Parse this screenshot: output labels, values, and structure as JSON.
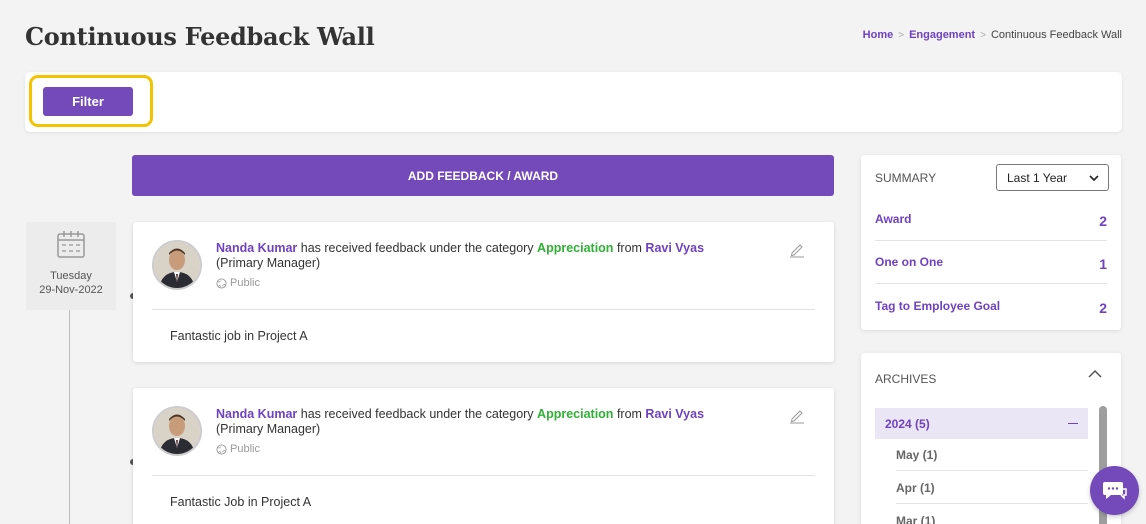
{
  "page": {
    "title": "Continuous Feedback Wall"
  },
  "breadcrumb": {
    "items": [
      "Home",
      "Engagement"
    ],
    "current": "Continuous Feedback Wall"
  },
  "filter": {
    "label": "Filter"
  },
  "add_feedback": {
    "label": "ADD FEEDBACK / AWARD"
  },
  "timeline": {
    "day": "Tuesday",
    "date": "29-Nov-2022"
  },
  "feed": [
    {
      "recipient": "Nanda Kumar",
      "phrase1": "has received feedback under the category",
      "category": "Appreciation",
      "phrase2": "from",
      "giver": "Ravi Vyas",
      "giver_role": "(Primary Manager)",
      "visibility": "Public",
      "message": "Fantastic job in Project A"
    },
    {
      "recipient": "Nanda Kumar",
      "phrase1": "has received feedback under the category",
      "category": "Appreciation",
      "phrase2": "from",
      "giver": "Ravi Vyas",
      "giver_role": "(Primary Manager)",
      "visibility": "Public",
      "message": "Fantastic Job in Project A"
    }
  ],
  "summary": {
    "header": "SUMMARY",
    "period": "Last 1 Year",
    "rows": [
      {
        "label": "Award",
        "count": "2"
      },
      {
        "label": "One on One",
        "count": "1"
      },
      {
        "label": "Tag to Employee Goal",
        "count": "2"
      }
    ]
  },
  "archives": {
    "header": "ARCHIVES",
    "year": "2024 (5)",
    "months": [
      "May (1)",
      "Apr (1)",
      "Mar (1)"
    ]
  },
  "colors": {
    "accent": "#7449b9",
    "link": "#6f42c1",
    "category": "#2eb135",
    "highlight": "#f2c300"
  },
  "icons": [
    "calendar-icon",
    "globe-icon",
    "edit-icon",
    "chevron-down-icon",
    "chevron-up-icon",
    "minus-icon",
    "chat-icon"
  ]
}
